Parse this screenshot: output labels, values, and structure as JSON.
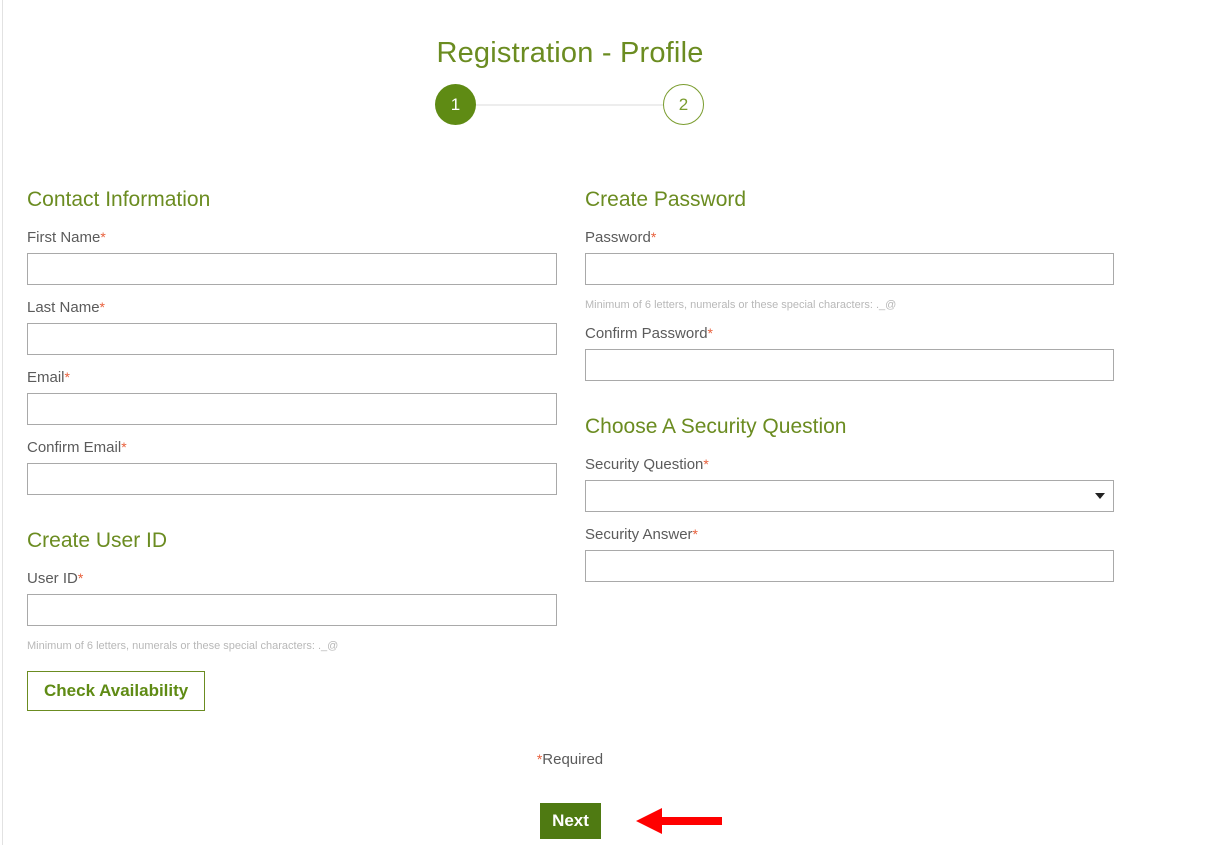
{
  "page": {
    "title": "Registration - Profile",
    "required_note": "*Required",
    "required_marker": "*"
  },
  "steps": {
    "current": "1",
    "next": "2"
  },
  "colors": {
    "accent_green": "#6b8c21",
    "step_active": "#5f8b14",
    "button_green": "#4f7a12",
    "required_red": "#e8603c",
    "annotation_red": "#ff0000",
    "input_border": "#a9a9a9",
    "hint_gray": "#b8b8b8"
  },
  "left_column": {
    "contact": {
      "heading": "Contact Information",
      "fields": [
        {
          "label": "First Name",
          "value": "",
          "required": true,
          "name": "first-name"
        },
        {
          "label": "Last Name",
          "value": "",
          "required": true,
          "name": "last-name"
        },
        {
          "label": "Email",
          "value": "",
          "required": true,
          "name": "email"
        },
        {
          "label": "Confirm Email",
          "value": "",
          "required": true,
          "name": "confirm-email"
        }
      ]
    },
    "user_id": {
      "heading": "Create User ID",
      "label": "User ID",
      "value": "",
      "hint": "Minimum of 6 letters, numerals or these special characters: ._@",
      "check_button": "Check Availability"
    }
  },
  "right_column": {
    "password": {
      "heading": "Create Password",
      "label": "Password",
      "value": "",
      "hint": "Minimum of 6 letters, numerals or these special characters: ._@",
      "confirm_label": "Confirm Password",
      "confirm_value": ""
    },
    "security": {
      "heading": "Choose A Security Question",
      "question_label": "Security Question",
      "question_value": "",
      "question_options": [
        ""
      ],
      "answer_label": "Security Answer",
      "answer_value": ""
    }
  },
  "footer": {
    "next_label": "Next"
  }
}
